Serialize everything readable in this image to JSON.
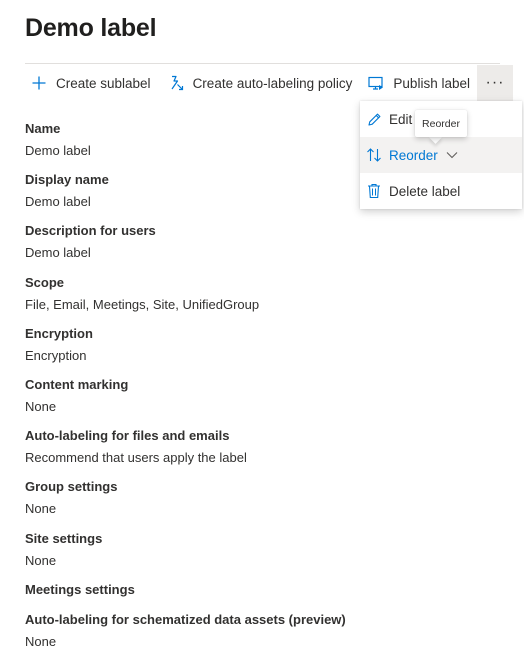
{
  "page": {
    "title": "Demo label"
  },
  "toolbar": {
    "create_sublabel": "Create sublabel",
    "create_auto_labeling_policy": "Create auto-labeling policy",
    "publish_label": "Publish label",
    "more": "···"
  },
  "properties": [
    {
      "label": "Name",
      "value": "Demo label"
    },
    {
      "label": "Display name",
      "value": "Demo label"
    },
    {
      "label": "Description for users",
      "value": "Demo label"
    },
    {
      "label": "Scope",
      "value": "File, Email, Meetings, Site, UnifiedGroup"
    },
    {
      "label": "Encryption",
      "value": "Encryption"
    },
    {
      "label": "Content marking",
      "value": "None"
    },
    {
      "label": "Auto-labeling for files and emails",
      "value": "Recommend that users apply the label"
    },
    {
      "label": "Group settings",
      "value": "None"
    },
    {
      "label": "Site settings",
      "value": "None"
    },
    {
      "label": "Meetings settings",
      "value": ""
    },
    {
      "label": "Auto-labeling for schematized data assets (preview)",
      "value": "None"
    }
  ],
  "menu": {
    "edit_label": "Edit l",
    "reorder": "Reorder",
    "delete_label": "Delete label"
  },
  "tooltip": {
    "text": "Reorder"
  },
  "colors": {
    "accent": "#0078d4",
    "text": "#323130",
    "hover_bg": "#f3f2f1",
    "more_bg": "#edebe9"
  },
  "icons": {
    "create_sublabel": "plus-icon",
    "create_auto_labeling_policy": "auto-label-icon",
    "publish_label": "publish-icon",
    "edit": "pencil-icon",
    "reorder": "sort-arrows-icon",
    "reorder_chevron": "chevron-down-icon",
    "delete": "trash-icon"
  }
}
